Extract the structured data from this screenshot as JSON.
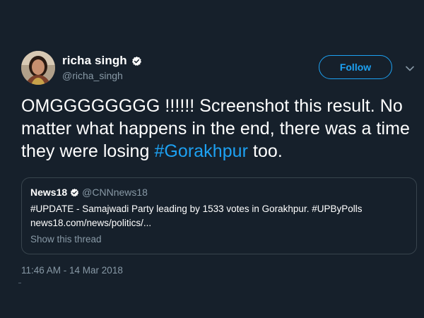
{
  "author": {
    "display_name": "richa singh",
    "handle": "@richa_singh",
    "verified": true
  },
  "follow_button": {
    "label": "Follow"
  },
  "tweet": {
    "text_before": "OMGGGGGGGG !!!!!! Screenshot this result. No matter what happens in the end, there was a time they were losing ",
    "hashtag": "#Gorakhpur",
    "text_after": " too.",
    "timestamp": "11:46 AM - 14 Mar 2018"
  },
  "quoted_tweet": {
    "display_name": "News18",
    "handle": "@CNNnews18",
    "verified": true,
    "line1": "#UPDATE - Samajwadi Party leading by 1533 votes in Gorakhpur. #UPByPolls",
    "line2": "news18.com/news/politics/...",
    "show_thread_label": "Show this thread"
  },
  "colors": {
    "background": "#16202b",
    "accent": "#1da1f2",
    "secondary_text": "#8899a6",
    "border": "#38444d"
  },
  "icons": {
    "verified": "verified-badge-icon",
    "caret": "chevron-down-icon",
    "avatar": "profile-photo"
  }
}
